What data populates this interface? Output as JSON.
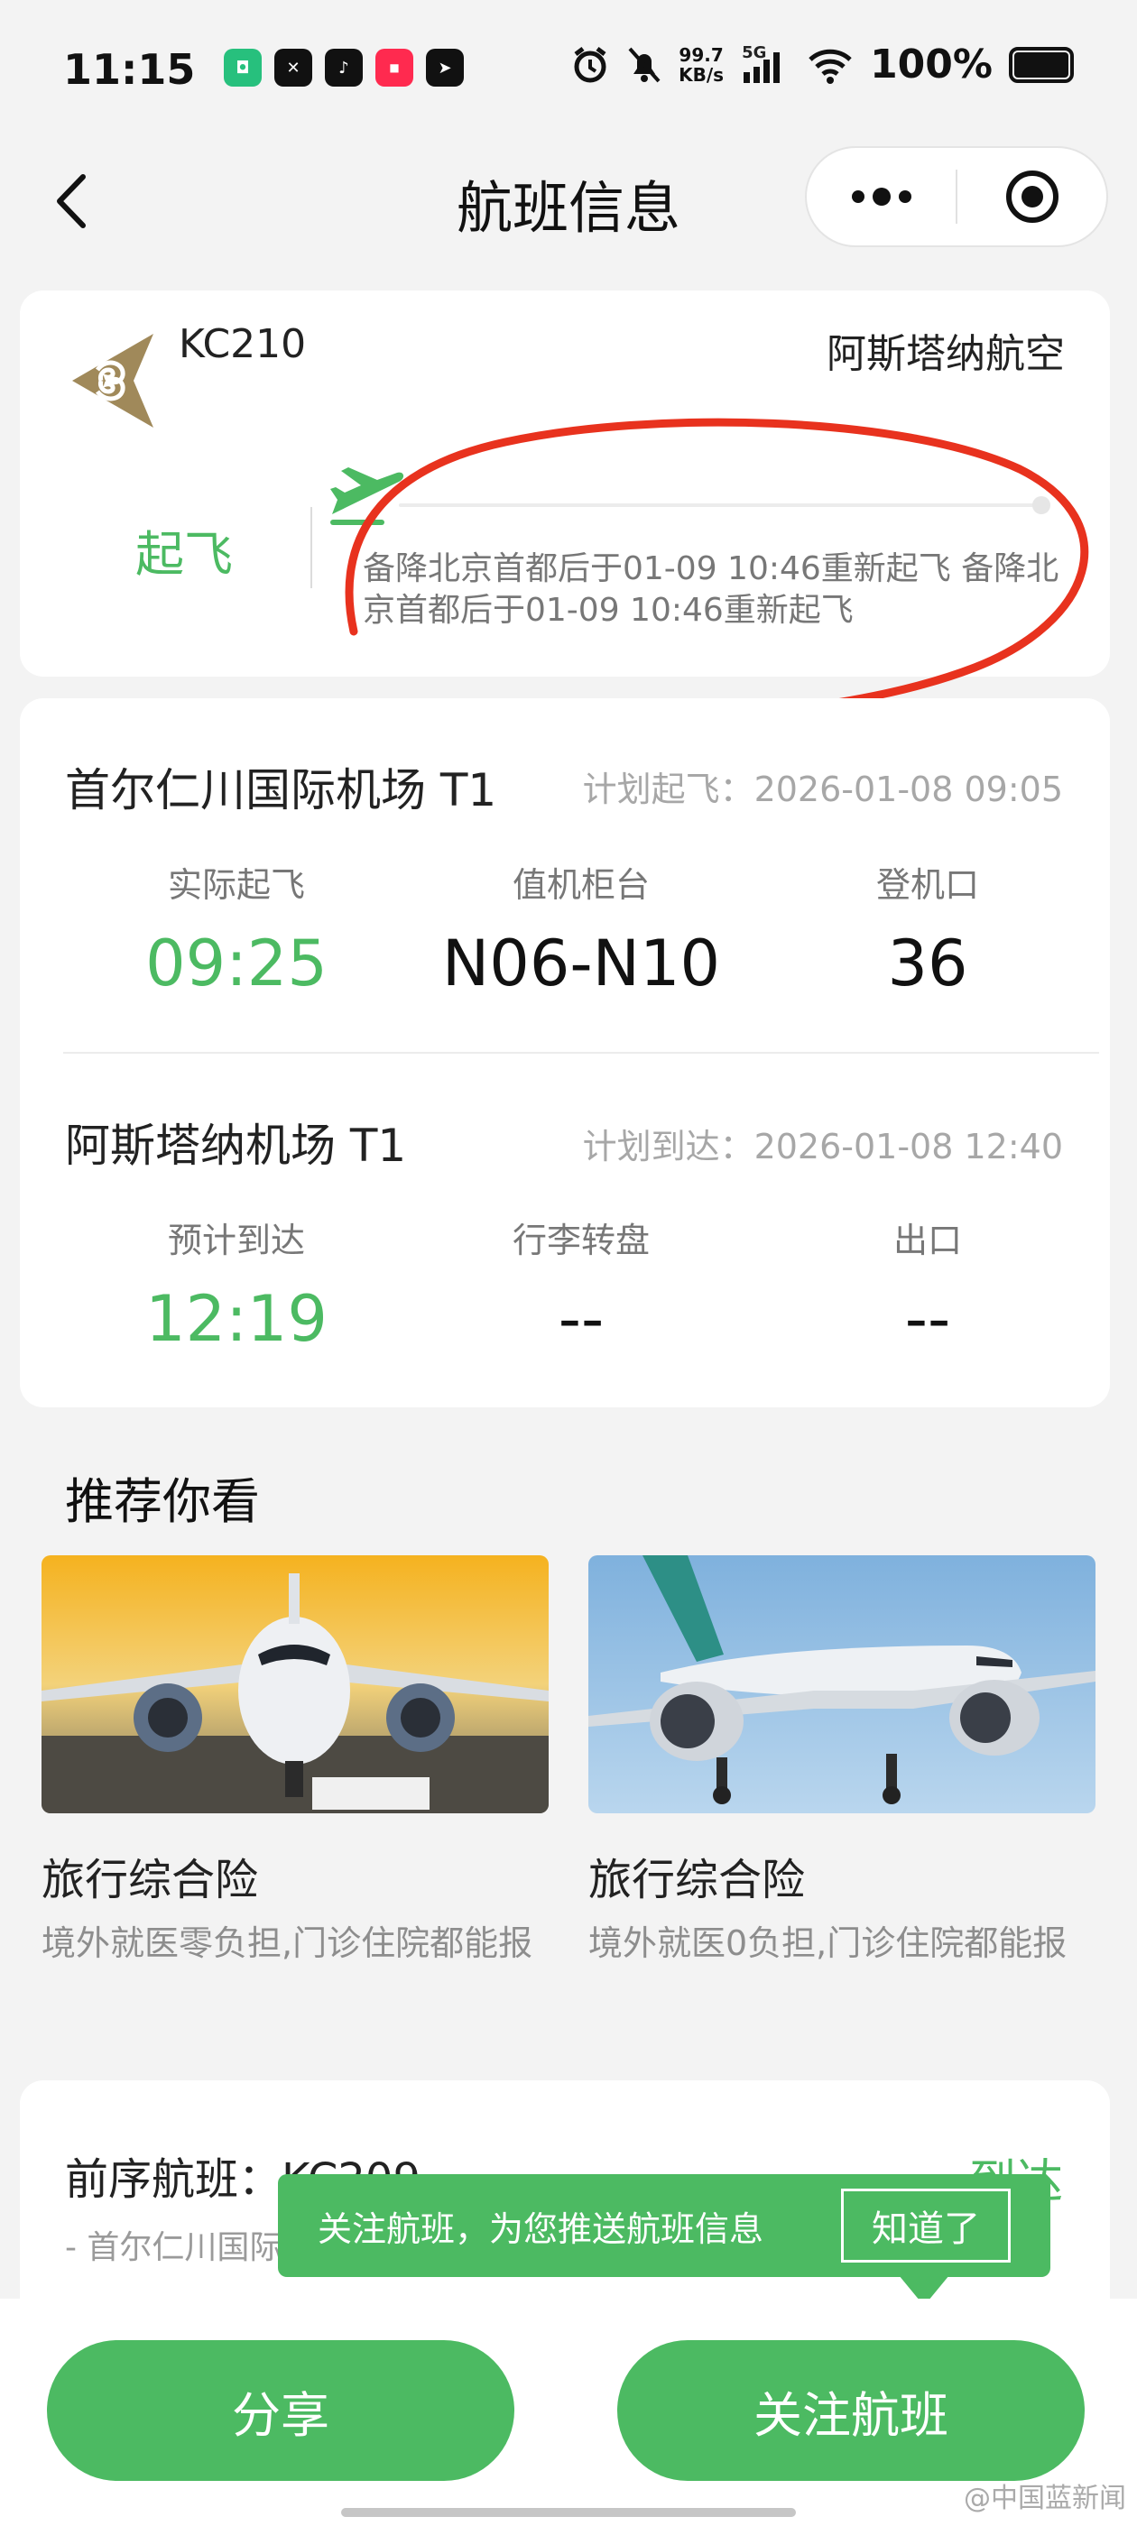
{
  "status_bar": {
    "time": "11:15",
    "net_speed_value": "99.7",
    "net_speed_unit": "KB/s",
    "signal_label": "5G",
    "battery": "100%"
  },
  "nav": {
    "title": "航班信息"
  },
  "flight": {
    "number": "KC210",
    "airline": "阿斯塔纳航空",
    "status": "起飞",
    "status_message": "备降北京首都后于01-09 10:46重新起飞 备降北京首都后于01-09 10:46重新起飞"
  },
  "departure": {
    "airport": "首尔仁川国际机场 T1",
    "plan_time": "计划起飞：2026-01-08 09:05",
    "cells": [
      {
        "label": "实际起飞",
        "value": "09:25"
      },
      {
        "label": "值机柜台",
        "value": "N06-N10"
      },
      {
        "label": "登机口",
        "value": "36"
      }
    ]
  },
  "arrival": {
    "airport": "阿斯塔纳机场 T1",
    "plan_time": "计划到达：2026-01-08 12:40",
    "cells": [
      {
        "label": "预计到达",
        "value": "12:19"
      },
      {
        "label": "行李转盘",
        "value": "--"
      },
      {
        "label": "出口",
        "value": "--"
      }
    ]
  },
  "recommend": {
    "title": "推荐你看",
    "items": [
      {
        "name": "旅行综合险",
        "desc": "境外就医零负担,门诊住院都能报"
      },
      {
        "name": "旅行综合险",
        "desc": "境外就医0负担,门诊住院都能报"
      }
    ]
  },
  "previous_flight": {
    "title": "前序航班：KC209",
    "status": "到达",
    "sub": "- 首尔仁川国际"
  },
  "tooltip": {
    "text": "关注航班，为您推送航班信息",
    "button": "知道了"
  },
  "bottom": {
    "share": "分享",
    "follow": "关注航班"
  },
  "watermark": "@中国蓝新闻",
  "colors": {
    "accent": "#4cba62",
    "annotation": "#e8321e"
  }
}
